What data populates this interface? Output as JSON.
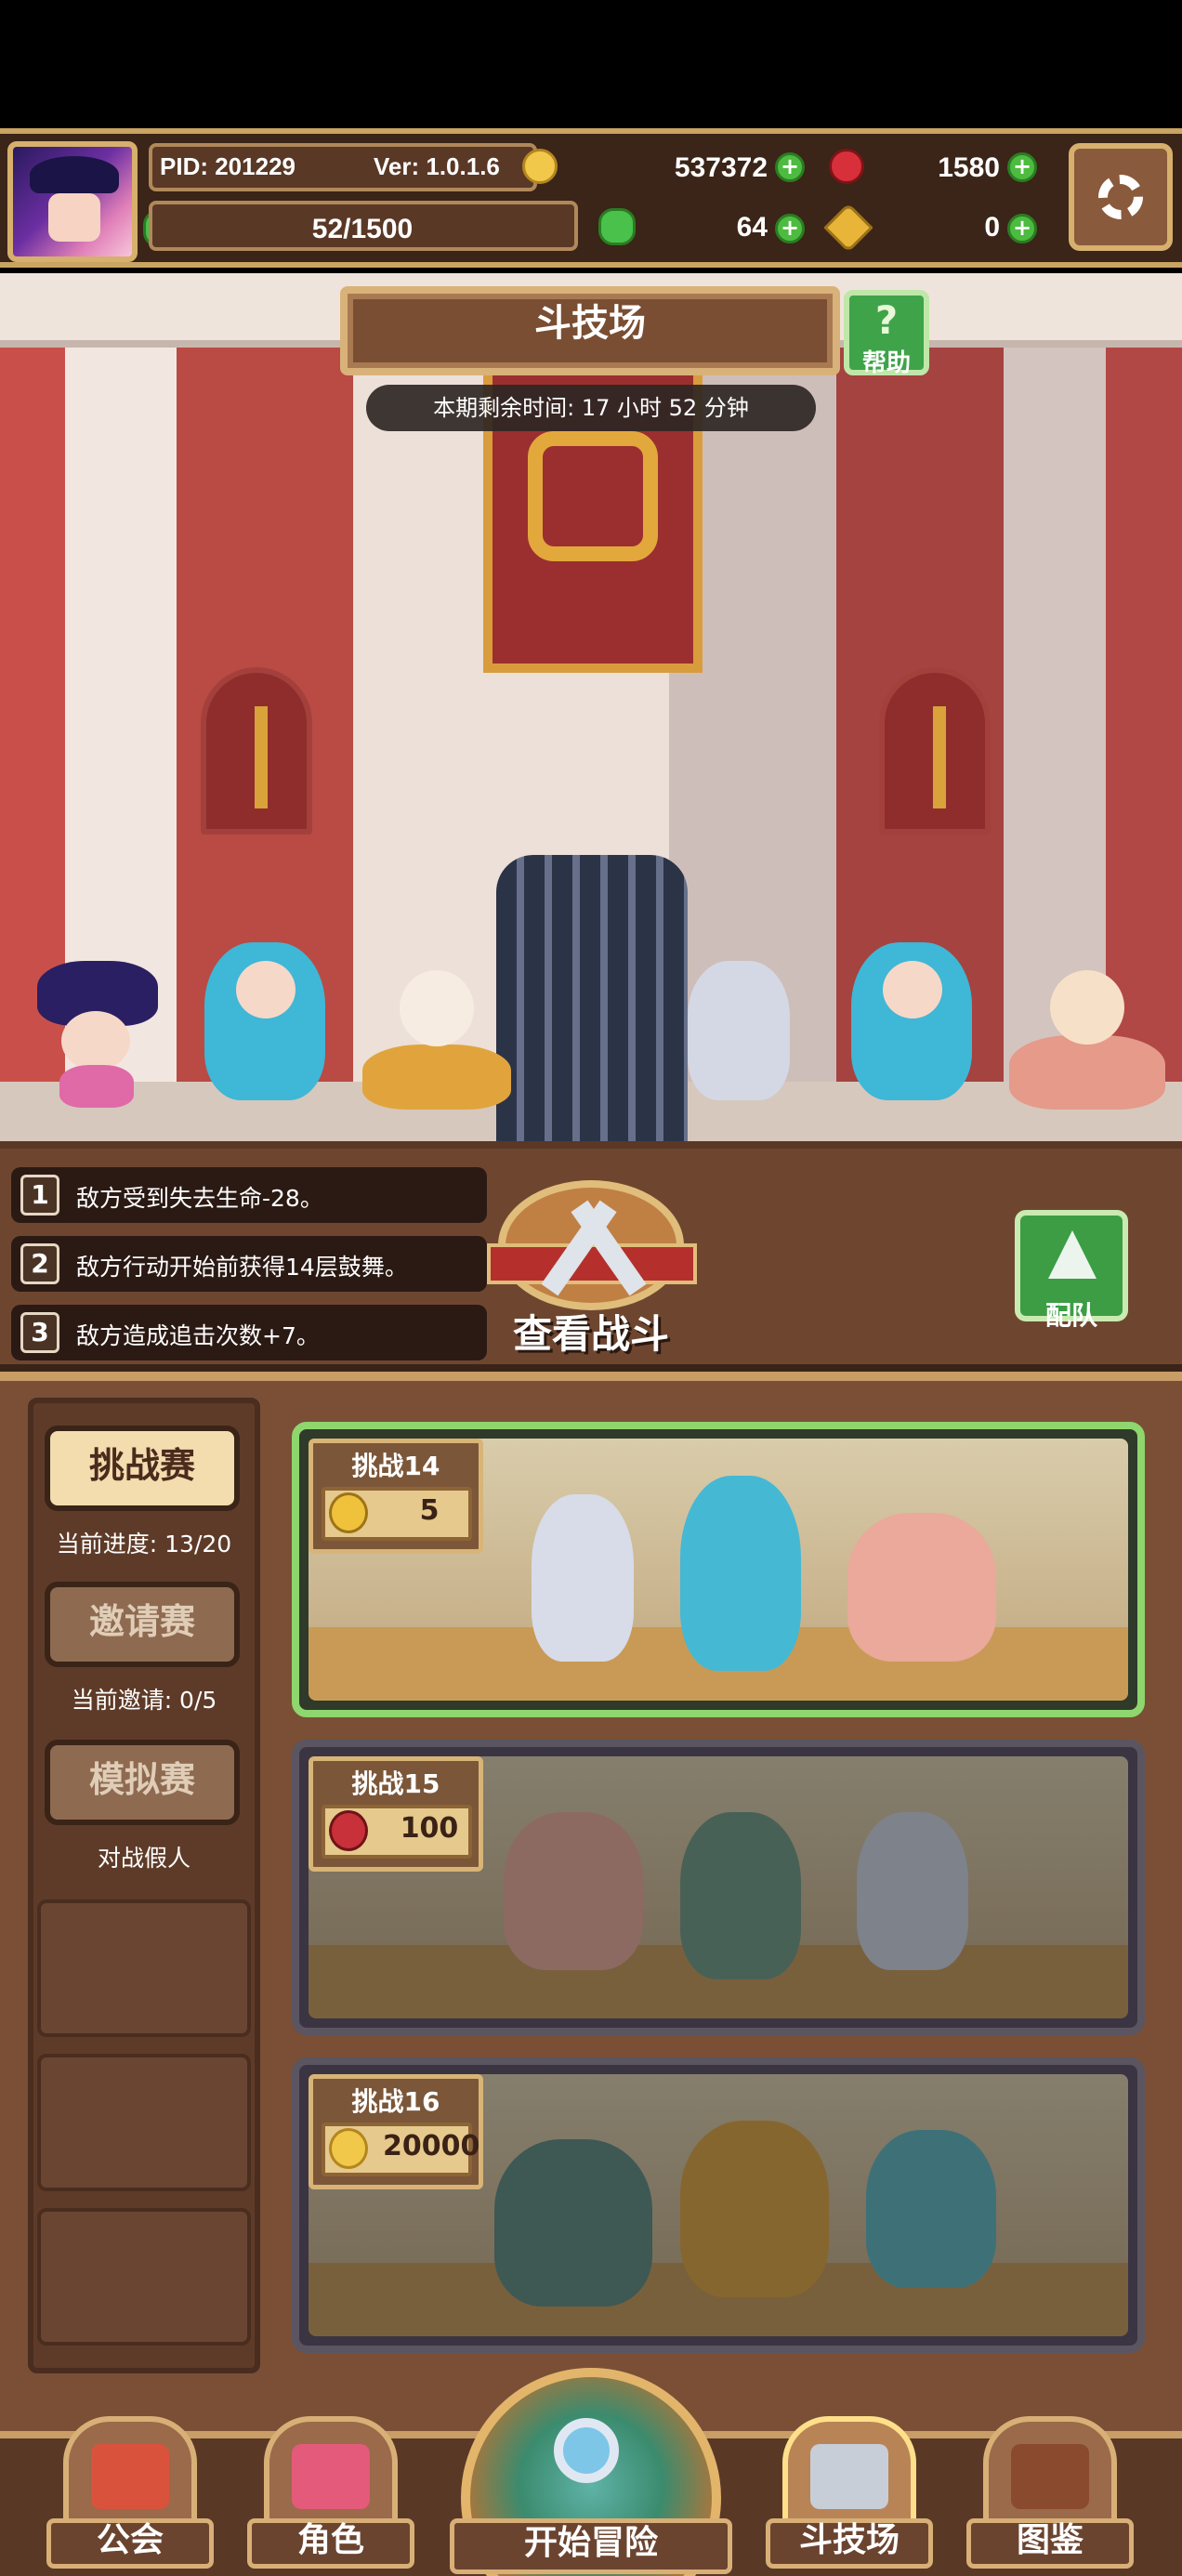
{
  "header": {
    "pid": "PID: 201229",
    "version": "Ver: 1.0.1.6",
    "gold": "537372",
    "ruby": "1580",
    "stamina": "52/1500",
    "clover": "64",
    "keys": "0",
    "icons": {
      "gold": "gold-coin-icon",
      "ruby": "ruby-gem-icon",
      "stamina": "green-clover-icon",
      "clover": "clover-icon",
      "keys": "gold-key-icon",
      "add": "plus-icon",
      "settings": "gear-icon"
    }
  },
  "arena": {
    "title": "斗技场",
    "help_label": "帮助",
    "help_icon": "question-mark-icon",
    "timer": "本期剩余时间: 17 小时 52 分钟"
  },
  "buffs": [
    {
      "num": "1",
      "text": "敌方受到失去生命-28。"
    },
    {
      "num": "2",
      "text": "敌方行动开始前获得14层鼓舞。"
    },
    {
      "num": "3",
      "text": "敌方造成追击次数+7。"
    }
  ],
  "battle": {
    "view_label": "查看战斗",
    "team_label": "配队"
  },
  "side_menu": {
    "challenge": {
      "label": "挑战赛",
      "sub": "当前进度: 13/20"
    },
    "invite": {
      "label": "邀请赛",
      "sub": "当前邀请: 0/5"
    },
    "simulate": {
      "label": "模拟赛",
      "sub": "对战假人"
    }
  },
  "challenges": [
    {
      "title": "挑战14",
      "reward": "5",
      "reward_icon": "gold-medal-icon"
    },
    {
      "title": "挑战15",
      "reward": "100",
      "reward_icon": "ruby-gem-icon"
    },
    {
      "title": "挑战16",
      "reward": "20000",
      "reward_icon": "gold-coin-icon"
    }
  ],
  "nav": {
    "guild": "公会",
    "character": "角色",
    "adventure": "开始冒险",
    "arena": "斗技场",
    "codex": "图鉴"
  },
  "colors": {
    "accent_gold": "#d6b06c",
    "panel_brown": "#7a4f36",
    "selected_green": "#8ed66d",
    "plus_green": "#4dbb3f",
    "ruby_red": "#d8303a"
  }
}
